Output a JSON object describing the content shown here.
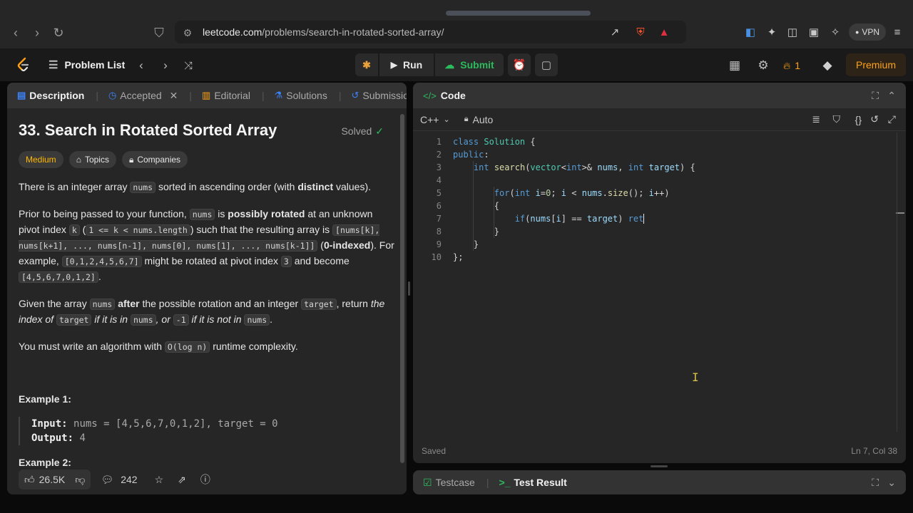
{
  "browser": {
    "url_domain": "leetcode.com",
    "url_path": "/problems/search-in-rotated-sorted-array/",
    "vpn_label": "VPN"
  },
  "lc": {
    "problem_list": "Problem List",
    "run": "Run",
    "submit": "Submit",
    "streak": "1",
    "premium": "Premium"
  },
  "left_tabs": {
    "description": "Description",
    "accepted": "Accepted",
    "editorial": "Editorial",
    "solutions": "Solutions",
    "submissions": "Submissions"
  },
  "problem": {
    "title": "33. Search in Rotated Sorted Array",
    "status": "Solved",
    "difficulty": "Medium",
    "topics": "Topics",
    "companies": "Companies",
    "p1_a": "There is an integer array ",
    "p1_code": "nums",
    "p1_b": " sorted in ascending order (with ",
    "p1_bold": "distinct",
    "p1_c": " values).",
    "p2_a": "Prior to being passed to your function, ",
    "p2_code1": "nums",
    "p2_b": " is ",
    "p2_bold": "possibly rotated",
    "p2_c": " at an unknown pivot index ",
    "p2_code2": "k",
    "p2_d": " (",
    "p2_code3": "1 <= k < nums.length",
    "p2_e": ") such that the resulting array is ",
    "p2_code4": "[nums[k], nums[k+1], ..., nums[n-1], nums[0], nums[1], ..., nums[k-1]]",
    "p2_f": " (",
    "p2_bold2": "0-indexed",
    "p2_g": "). For example, ",
    "p2_code5": "[0,1,2,4,5,6,7]",
    "p2_h": " might be rotated at pivot index ",
    "p2_code6": "3",
    "p2_i": " and become ",
    "p2_code7": "[4,5,6,7,0,1,2]",
    "p2_j": ".",
    "p3_a": "Given the array ",
    "p3_code1": "nums",
    "p3_bold": "after",
    "p3_b": " the possible rotation and an integer ",
    "p3_code2": "target",
    "p3_c": ", return ",
    "p3_it1": "the index of ",
    "p3_code3": "target",
    "p3_it2": " if it is in ",
    "p3_code4": "nums",
    "p3_it3": ", or ",
    "p3_code5": "-1",
    "p3_it4": " if it is not in ",
    "p3_code6": "nums",
    "p3_d": ".",
    "p4_a": "You must write an algorithm with ",
    "p4_code": "O(log n)",
    "p4_b": " runtime complexity.",
    "ex1_title": "Example 1:",
    "ex1_input_label": "Input:",
    "ex1_input": "nums = [4,5,6,7,0,1,2], target = 0",
    "ex1_output_label": "Output:",
    "ex1_output": "4",
    "ex2_title": "Example 2:"
  },
  "footer": {
    "likes": "26.5K",
    "comments": "242"
  },
  "code_panel": {
    "title": "Code",
    "language": "C++",
    "auto": "Auto",
    "status": "Saved",
    "position": "Ln 7, Col 38"
  },
  "code_lines": [
    "1",
    "2",
    "3",
    "4",
    "5",
    "6",
    "7",
    "8",
    "9",
    "10"
  ],
  "bottom_panel": {
    "testcase": "Testcase",
    "test_result": "Test Result"
  },
  "colors": {
    "accent_green": "#2cbb5d",
    "accent_orange": "#ffa116",
    "medium_yellow": "#ffb800",
    "link_blue": "#3b82f6"
  }
}
